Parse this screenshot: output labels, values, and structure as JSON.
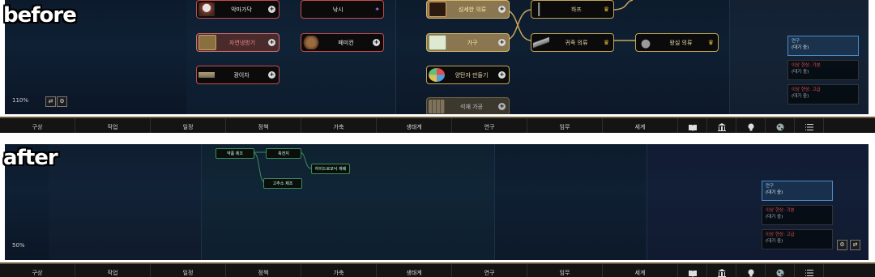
{
  "labels": {
    "before": "before",
    "after": "after"
  },
  "tabs": [
    "구상",
    "작업",
    "일정",
    "정책",
    "가축",
    "생태계",
    "연구",
    "임무",
    "세계"
  ],
  "tab_icons": [
    "book-icon",
    "building-icon",
    "lightbulb-icon",
    "globe-icon",
    "list-icon"
  ],
  "before": {
    "zoom": "110%",
    "nodes": [
      {
        "name": "node-mushroom",
        "label": "악마가닥",
        "style": "red"
      },
      {
        "name": "node-fishing",
        "label": "낚시",
        "style": "red"
      },
      {
        "name": "node-natural-cooling",
        "label": "자연냉방기",
        "style": "pink"
      },
      {
        "name": "node-pemmican",
        "label": "페미컨",
        "style": "red"
      },
      {
        "name": "node-mine-cart",
        "label": "광이차",
        "style": "red"
      },
      {
        "name": "node-fine-clothes",
        "label": "섬세한 의류",
        "style": "tan"
      },
      {
        "name": "node-harp",
        "label": "하프",
        "style": "gold"
      },
      {
        "name": "node-furniture",
        "label": "가구",
        "style": "tan"
      },
      {
        "name": "node-noble-clothes",
        "label": "귀족 의류",
        "style": "gold"
      },
      {
        "name": "node-royal-clothes",
        "label": "왕실 의류",
        "style": "gold"
      },
      {
        "name": "node-parasol",
        "label": "양탄자 만들기",
        "style": "gold"
      },
      {
        "name": "node-stone-cutting",
        "label": "석재 가공",
        "style": "dim"
      }
    ],
    "queue": [
      {
        "title": "연구",
        "status": "(대기 중)"
      },
      {
        "title": "이상 현상: 기본",
        "status": "(대기 중)"
      },
      {
        "title": "이상 현상: 고급",
        "status": "(대기 중)"
      }
    ]
  },
  "after": {
    "zoom": "50%",
    "nodes": [
      {
        "name": "node-medicine-production",
        "label": "약품 제조"
      },
      {
        "name": "node-quarry",
        "label": "축전지"
      },
      {
        "name": "node-hydroponics",
        "label": "하이드로포닉 재배"
      },
      {
        "name": "node-drug-production",
        "label": "고추소 제조"
      }
    ],
    "queue": [
      {
        "title": "연구",
        "status": "(대기 중)"
      },
      {
        "title": "이상 현상: 기본",
        "status": "(대기 중)"
      },
      {
        "title": "이상 현상: 고급",
        "status": "(대기 중)"
      }
    ]
  }
}
